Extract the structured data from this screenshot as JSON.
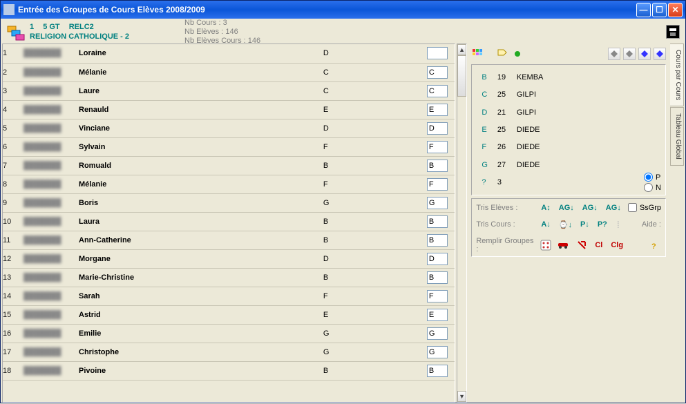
{
  "window": {
    "title": "Entrée des Groupes de Cours Elèves 2008/2009"
  },
  "course": {
    "seq": "1",
    "level": "5 GT",
    "code": "RELC2",
    "name": "RELIGION CATHOLIQUE - 2"
  },
  "stats": {
    "nb_cours": "Nb Cours : 3",
    "nb_eleves": "Nb Elèves : 146",
    "nb_eleves_cours": "Nb Elèves Cours : 146"
  },
  "students": [
    {
      "n": "1",
      "first": "Loraine",
      "g1": "D",
      "g2": ""
    },
    {
      "n": "2",
      "first": "Mélanie",
      "g1": "C",
      "g2": "C"
    },
    {
      "n": "3",
      "first": "Laure",
      "g1": "C",
      "g2": "C"
    },
    {
      "n": "4",
      "first": "Renauld",
      "g1": "E",
      "g2": "E"
    },
    {
      "n": "5",
      "first": "Vinciane",
      "g1": "D",
      "g2": "D"
    },
    {
      "n": "6",
      "first": "Sylvain",
      "g1": "F",
      "g2": "F"
    },
    {
      "n": "7",
      "first": "Romuald",
      "g1": "B",
      "g2": "B"
    },
    {
      "n": "8",
      "first": "Mélanie",
      "g1": "F",
      "g2": "F"
    },
    {
      "n": "9",
      "first": "Boris",
      "g1": "G",
      "g2": "G"
    },
    {
      "n": "10",
      "first": "Laura",
      "g1": "B",
      "g2": "B"
    },
    {
      "n": "11",
      "first": "Ann-Catherine",
      "g1": "B",
      "g2": "B"
    },
    {
      "n": "12",
      "first": "Morgane",
      "g1": "D",
      "g2": "D"
    },
    {
      "n": "13",
      "first": "Marie-Christine",
      "g1": "B",
      "g2": "B"
    },
    {
      "n": "14",
      "first": "Sarah",
      "g1": "F",
      "g2": "F"
    },
    {
      "n": "15",
      "first": "Astrid",
      "g1": "E",
      "g2": "E"
    },
    {
      "n": "16",
      "first": "Emilie",
      "g1": "G",
      "g2": "G"
    },
    {
      "n": "17",
      "first": "Christophe",
      "g1": "G",
      "g2": "G"
    },
    {
      "n": "18",
      "first": "Pivoine",
      "g1": "B",
      "g2": "B"
    }
  ],
  "groups": [
    {
      "letter": "B",
      "count": "19",
      "teacher": "KEMBA"
    },
    {
      "letter": "C",
      "count": "25",
      "teacher": "GILPI"
    },
    {
      "letter": "D",
      "count": "21",
      "teacher": "GILPI"
    },
    {
      "letter": "E",
      "count": "25",
      "teacher": "DIEDE"
    },
    {
      "letter": "F",
      "count": "26",
      "teacher": "DIEDE"
    },
    {
      "letter": "G",
      "count": "27",
      "teacher": "DIEDE"
    },
    {
      "letter": "?",
      "count": "3",
      "teacher": ""
    }
  ],
  "pn": {
    "p": "P",
    "n": "N"
  },
  "controls": {
    "tris_eleves": "Tris Elèves :",
    "tris_cours": "Tris Cours :",
    "remplir": "Remplir Groupes :",
    "aide": "Aide :",
    "ssgrp": "SsGrp",
    "cl": "Cl",
    "clg": "Clg"
  },
  "tabs": {
    "tab1": "Cours par Cours",
    "tab2": "Tableau Global"
  }
}
